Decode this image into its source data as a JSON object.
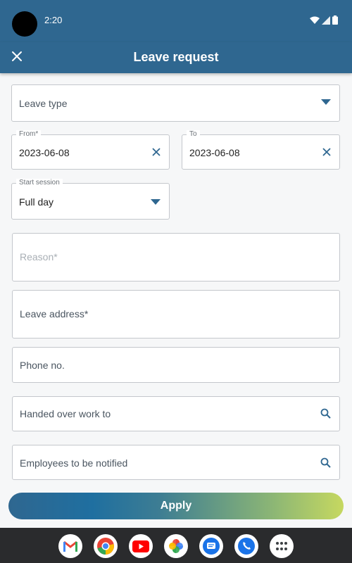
{
  "status_bar": {
    "time": "2:20"
  },
  "app_bar": {
    "title": "Leave request"
  },
  "form": {
    "leave_type": {
      "placeholder": "Leave type"
    },
    "from": {
      "label": "From*",
      "value": "2023-06-08"
    },
    "to": {
      "label": "To",
      "value": "2023-06-08"
    },
    "start_session": {
      "label": "Start session",
      "value": "Full day"
    },
    "reason": {
      "placeholder": "Reason*"
    },
    "leave_address": {
      "placeholder": "Leave address*"
    },
    "phone": {
      "placeholder": "Phone no."
    },
    "handed_over": {
      "placeholder": "Handed over work to"
    },
    "employees_notified": {
      "placeholder": "Employees to be notified"
    }
  },
  "apply_button": {
    "label": "Apply"
  },
  "dock": {
    "apps": [
      "gmail-icon",
      "chrome-icon",
      "youtube-icon",
      "photos-icon",
      "messages-icon",
      "phone-icon",
      "app-drawer-icon"
    ]
  },
  "colors": {
    "primary": "#2f6790",
    "accent_end": "#c6d860",
    "icon": "#2f6790"
  }
}
